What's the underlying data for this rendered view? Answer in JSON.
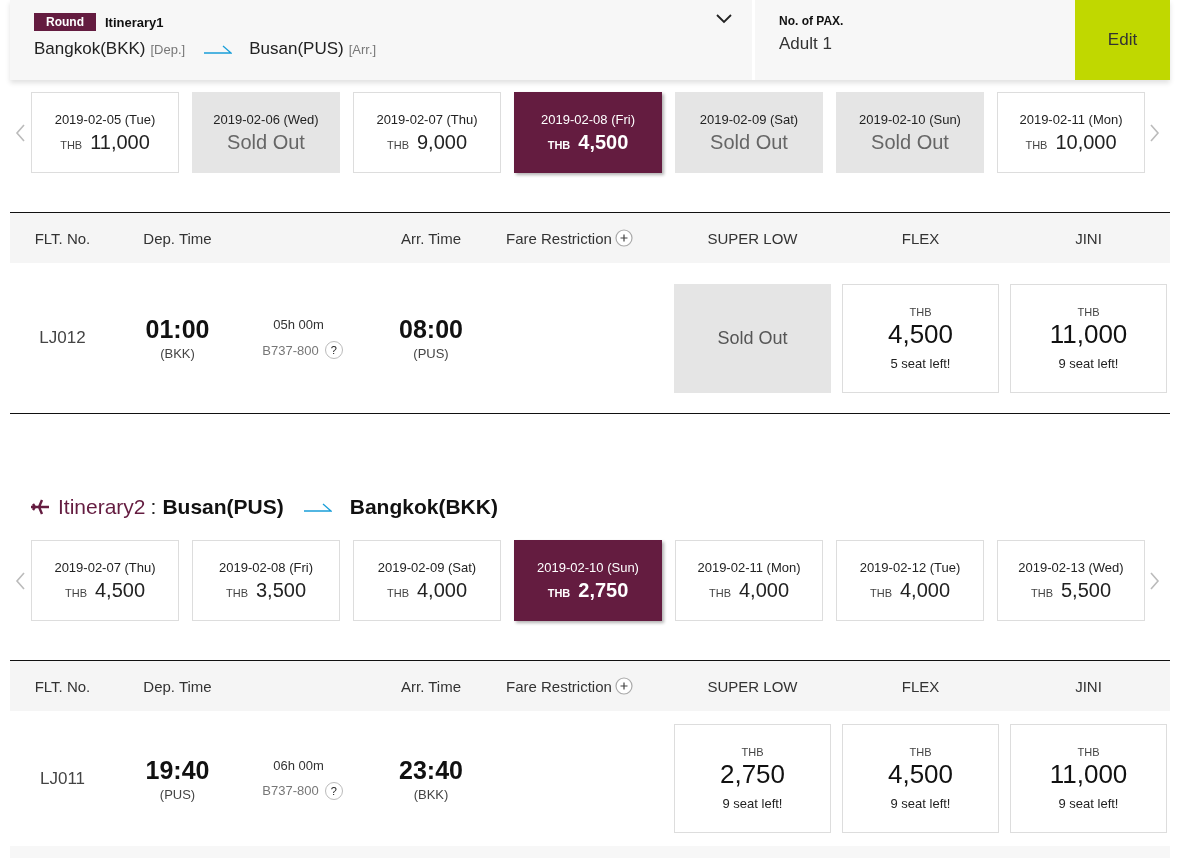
{
  "search_bar": {
    "trip_type": "Round",
    "itinerary_label": "Itinerary1",
    "origin": "Bangkok(BKK)",
    "origin_tag": "[Dep.]",
    "destination": "Busan(PUS)",
    "destination_tag": "[Arr.]",
    "pax_label": "No. of PAX.",
    "pax_value": "Adult 1",
    "edit_button": "Edit"
  },
  "itineraries": [
    {
      "dates": [
        {
          "kind": "price",
          "date": "2019-02-05 (Tue)",
          "currency": "THB",
          "price": "11,000",
          "selected": false
        },
        {
          "kind": "sold_out",
          "date": "2019-02-06 (Wed)",
          "text": "Sold Out",
          "selected": false
        },
        {
          "kind": "price",
          "date": "2019-02-07 (Thu)",
          "currency": "THB",
          "price": "9,000",
          "selected": false
        },
        {
          "kind": "price",
          "date": "2019-02-08 (Fri)",
          "currency": "THB",
          "price": "4,500",
          "selected": true
        },
        {
          "kind": "sold_out",
          "date": "2019-02-09 (Sat)",
          "text": "Sold Out",
          "selected": false
        },
        {
          "kind": "sold_out",
          "date": "2019-02-10 (Sun)",
          "text": "Sold Out",
          "selected": false
        },
        {
          "kind": "price",
          "date": "2019-02-11 (Mon)",
          "currency": "THB",
          "price": "10,000",
          "selected": false
        }
      ],
      "table": {
        "columns": [
          "FLT. No.",
          "Dep. Time",
          "Arr. Time",
          "Fare Restriction",
          "SUPER LOW",
          "FLEX",
          "JINI"
        ],
        "flights": [
          {
            "number": "LJ012",
            "dep_time": "01:00",
            "dep_airport": "(BKK)",
            "duration": "05h 00m",
            "aircraft": "B737-800",
            "help": "?",
            "arr_time": "08:00",
            "arr_airport": "(PUS)",
            "fares": [
              {
                "kind": "sold_out",
                "text": "Sold Out"
              },
              {
                "kind": "price",
                "currency": "THB",
                "price": "4,500",
                "seats": "5 seat left!"
              },
              {
                "kind": "price",
                "currency": "THB",
                "price": "11,000",
                "seats": "9 seat left!"
              }
            ]
          }
        ]
      }
    },
    {
      "heading": {
        "label": "Itinerary2",
        "separator": ":",
        "origin": "Busan(PUS)",
        "destination": "Bangkok(BKK)"
      },
      "dates": [
        {
          "kind": "price",
          "date": "2019-02-07 (Thu)",
          "currency": "THB",
          "price": "4,500",
          "selected": false
        },
        {
          "kind": "price",
          "date": "2019-02-08 (Fri)",
          "currency": "THB",
          "price": "3,500",
          "selected": false
        },
        {
          "kind": "price",
          "date": "2019-02-09 (Sat)",
          "currency": "THB",
          "price": "4,000",
          "selected": false
        },
        {
          "kind": "price",
          "date": "2019-02-10 (Sun)",
          "currency": "THB",
          "price": "2,750",
          "selected": true
        },
        {
          "kind": "price",
          "date": "2019-02-11 (Mon)",
          "currency": "THB",
          "price": "4,000",
          "selected": false
        },
        {
          "kind": "price",
          "date": "2019-02-12 (Tue)",
          "currency": "THB",
          "price": "4,000",
          "selected": false
        },
        {
          "kind": "price",
          "date": "2019-02-13 (Wed)",
          "currency": "THB",
          "price": "5,500",
          "selected": false
        }
      ],
      "table": {
        "columns": [
          "FLT. No.",
          "Dep. Time",
          "Arr. Time",
          "Fare Restriction",
          "SUPER LOW",
          "FLEX",
          "JINI"
        ],
        "flights": [
          {
            "number": "LJ011",
            "dep_time": "19:40",
            "dep_airport": "(PUS)",
            "duration": "06h 00m",
            "aircraft": "B737-800",
            "help": "?",
            "arr_time": "23:40",
            "arr_airport": "(BKK)",
            "fares": [
              {
                "kind": "price",
                "currency": "THB",
                "price": "2,750",
                "seats": "9 seat left!"
              },
              {
                "kind": "price",
                "currency": "THB",
                "price": "4,500",
                "seats": "9 seat left!"
              },
              {
                "kind": "price",
                "currency": "THB",
                "price": "11,000",
                "seats": "9 seat left!"
              }
            ]
          }
        ]
      }
    }
  ]
}
